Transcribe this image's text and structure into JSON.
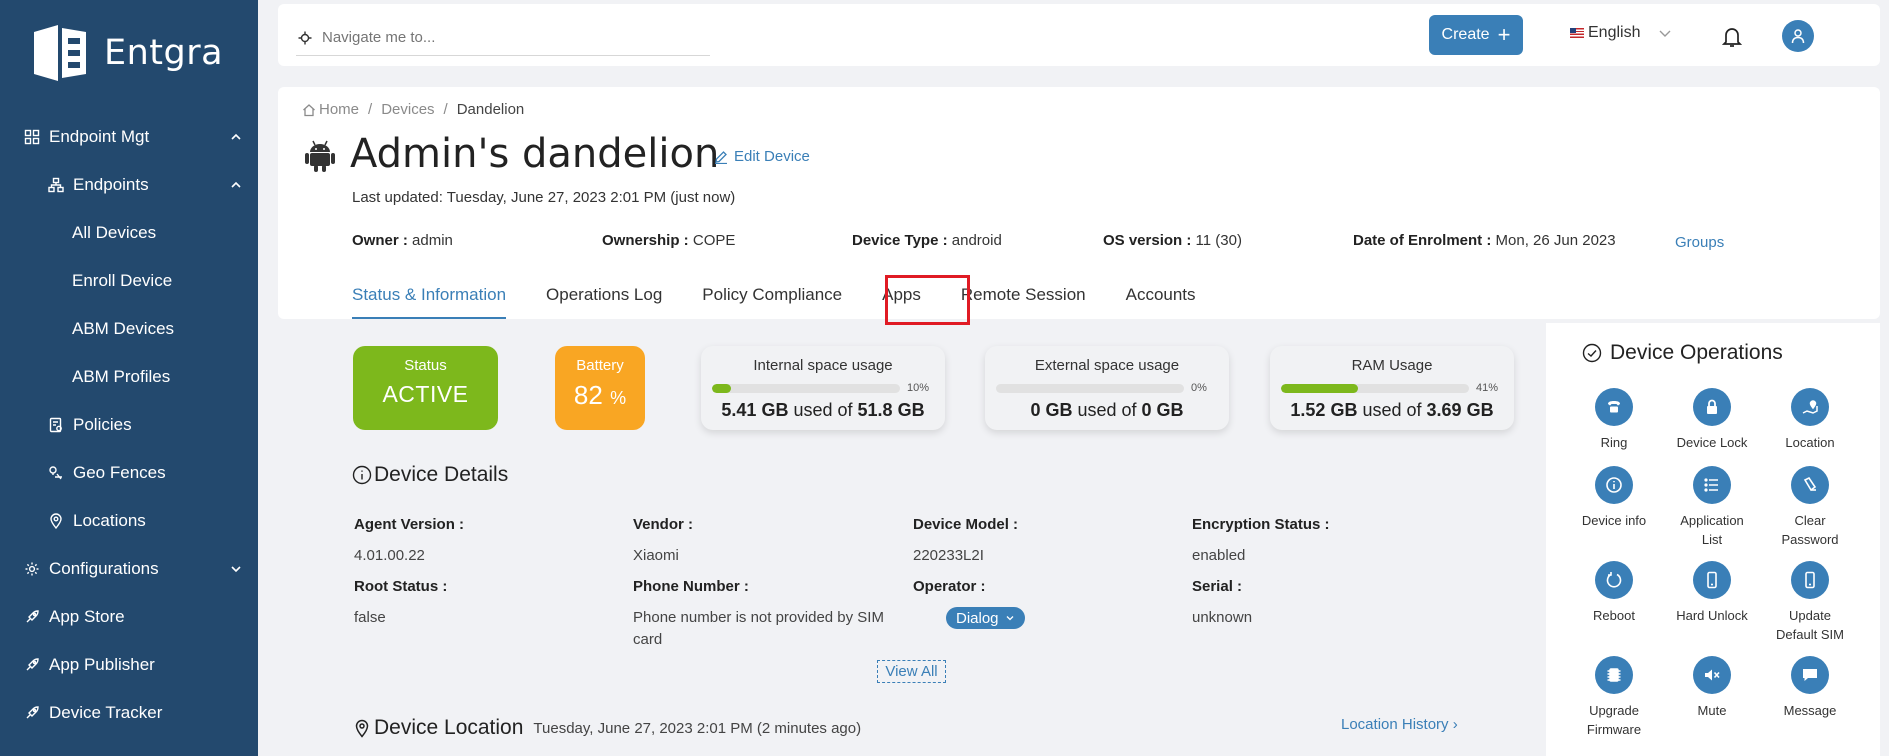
{
  "sidebar": {
    "brand": "Entgra",
    "items": [
      {
        "label": "Endpoint Mgt"
      },
      {
        "label": "Endpoints"
      },
      {
        "label": "All Devices"
      },
      {
        "label": "Enroll Device"
      },
      {
        "label": "ABM Devices"
      },
      {
        "label": "ABM Profiles"
      },
      {
        "label": "Policies"
      },
      {
        "label": "Geo Fences"
      },
      {
        "label": "Locations"
      },
      {
        "label": "Configurations"
      },
      {
        "label": "App Store"
      },
      {
        "label": "App Publisher"
      },
      {
        "label": "Device Tracker"
      }
    ]
  },
  "topbar": {
    "search_placeholder": "Navigate me to...",
    "create_label": "Create",
    "language": "English"
  },
  "breadcrumb": [
    "Home",
    "Devices",
    "Dandelion"
  ],
  "device": {
    "title": "Admin's dandelion",
    "edit_label": "Edit Device",
    "last_updated": "Last updated: Tuesday, June 27, 2023 2:01 PM (just now)",
    "meta": [
      {
        "label": "Owner :",
        "value": "admin"
      },
      {
        "label": "Ownership :",
        "value": "COPE"
      },
      {
        "label": "Device Type :",
        "value": "android"
      },
      {
        "label": "OS version :",
        "value": "11 (30)"
      },
      {
        "label": "Date of Enrolment :",
        "value": "Mon, 26 Jun 2023"
      }
    ],
    "groups_label": "Groups"
  },
  "tabs": [
    {
      "label": "Status & Information",
      "active": true
    },
    {
      "label": "Operations Log"
    },
    {
      "label": "Policy Compliance"
    },
    {
      "label": "Apps"
    },
    {
      "label": "Remote Session"
    },
    {
      "label": "Accounts"
    }
  ],
  "stats": {
    "status": {
      "label": "Status",
      "value": "ACTIVE"
    },
    "battery": {
      "label": "Battery",
      "value": "82",
      "unit": "%"
    },
    "usage": [
      {
        "label": "Internal space usage",
        "percent": 10,
        "percent_label": "10%",
        "used": "5.41 GB",
        "sep": "used of",
        "total": "51.8 GB"
      },
      {
        "label": "External space usage",
        "percent": 0,
        "percent_label": "0%",
        "used": "0 GB",
        "sep": "used of",
        "total": "0 GB"
      },
      {
        "label": "RAM Usage",
        "percent": 41,
        "percent_label": "41%",
        "used": "1.52 GB",
        "sep": "used of",
        "total": "3.69 GB"
      }
    ]
  },
  "details": {
    "title": "Device Details",
    "fields": [
      {
        "label": "Agent Version",
        "value": "4.01.00.22"
      },
      {
        "label": "Vendor",
        "value": "Xiaomi"
      },
      {
        "label": "Device Model",
        "value": "220233L2I"
      },
      {
        "label": "Encryption Status",
        "value": "enabled"
      },
      {
        "label": "Root Status",
        "value": "false"
      },
      {
        "label": "Phone Number",
        "value_line1": "Phone number is not provided by SIM",
        "value_line2": "card"
      },
      {
        "label": "Operator",
        "value": "Dialog"
      },
      {
        "label": "Serial",
        "value": "unknown"
      }
    ],
    "view_all": "View All"
  },
  "location": {
    "title": "Device Location",
    "time": "Tuesday, June 27, 2023 2:01 PM (2 minutes ago)",
    "history_label": "Location History"
  },
  "operations": {
    "title": "Device Operations",
    "items": [
      {
        "label": "Ring",
        "icon": "phone-icon"
      },
      {
        "label": "Device Lock",
        "icon": "lock-icon"
      },
      {
        "label": "Location",
        "icon": "map-icon"
      },
      {
        "label": "Device info",
        "icon": "info-icon"
      },
      {
        "label": "Application",
        "label2": "List",
        "icon": "list-icon"
      },
      {
        "label": "Clear",
        "label2": "Password",
        "icon": "eraser-icon"
      },
      {
        "label": "Reboot",
        "icon": "reboot-icon"
      },
      {
        "label": "Hard Unlock",
        "icon": "mobile-icon"
      },
      {
        "label": "Update",
        "label2": "Default SIM",
        "icon": "sim-icon"
      },
      {
        "label": "Upgrade",
        "label2": "Firmware",
        "icon": "chip-icon"
      },
      {
        "label": "Mute",
        "icon": "mute-icon"
      },
      {
        "label": "Message",
        "icon": "message-icon"
      }
    ]
  },
  "colors": {
    "sidebar_bg": "#23496e",
    "accent": "#3a7fb7",
    "status_active": "#7db81c",
    "battery": "#f9a623",
    "highlight": "#e01b24"
  }
}
